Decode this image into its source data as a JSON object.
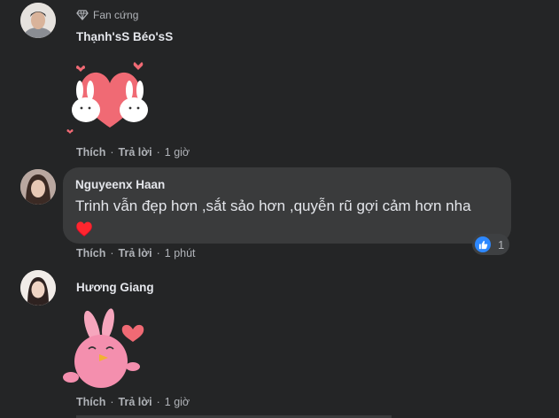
{
  "comments": [
    {
      "badge": "Fan cứng",
      "author": "Thạnh'sS Béo'sS",
      "actions": {
        "like": "Thích",
        "reply": "Trả lời",
        "time": "1 giờ"
      }
    },
    {
      "author": "Nguyeenx Haan",
      "text": "Trinh vẫn đẹp hơn ,sắt sảo hơn ,quyễn rũ gợi cảm hơn nha",
      "emoji": "♥️",
      "reaction_count": "1",
      "actions": {
        "like": "Thích",
        "reply": "Trả lời",
        "time": "1 phút"
      }
    },
    {
      "author": "Hương Giang",
      "actions": {
        "like": "Thích",
        "reply": "Trả lời",
        "time": "1 giờ"
      }
    }
  ],
  "colors": {
    "background": "#242526",
    "bubble": "#3a3b3c",
    "like_blue": "#2d88ff",
    "heart_red": "#e41e3f"
  }
}
